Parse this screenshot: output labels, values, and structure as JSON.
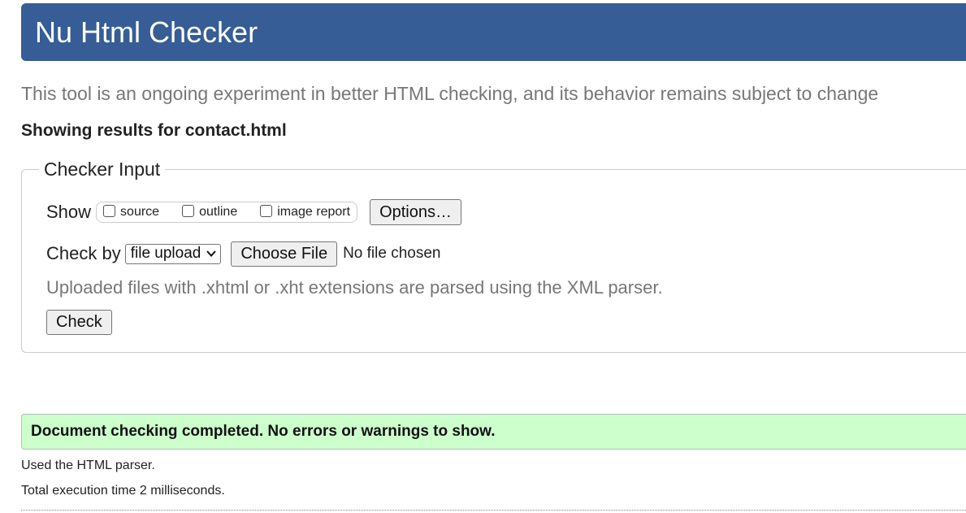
{
  "header": {
    "title": "Nu Html Checker"
  },
  "intro": {
    "text": "This tool is an ongoing experiment in better HTML checking, and its behavior remains subject to change"
  },
  "results_heading": "Showing results for contact.html",
  "checker_input": {
    "legend": "Checker Input",
    "show_label": "Show",
    "show_options": [
      {
        "label": "source",
        "checked": false
      },
      {
        "label": "outline",
        "checked": false
      },
      {
        "label": "image report",
        "checked": false
      }
    ],
    "options_button": "Options…",
    "check_by_label": "Check by",
    "check_by_selected": "file upload",
    "choose_file_button": "Choose File",
    "no_file_text": "No file chosen",
    "hint": "Uploaded files with .xhtml or .xht extensions are parsed using the XML parser.",
    "check_button": "Check"
  },
  "result": {
    "success_message": "Document checking completed. No errors or warnings to show.",
    "parser_note": "Used the HTML parser.",
    "execution_time": "Total execution time 2 milliseconds."
  },
  "colors": {
    "banner_bg": "#365d95",
    "success_bg": "#ccffcc",
    "muted_text": "#777777"
  }
}
